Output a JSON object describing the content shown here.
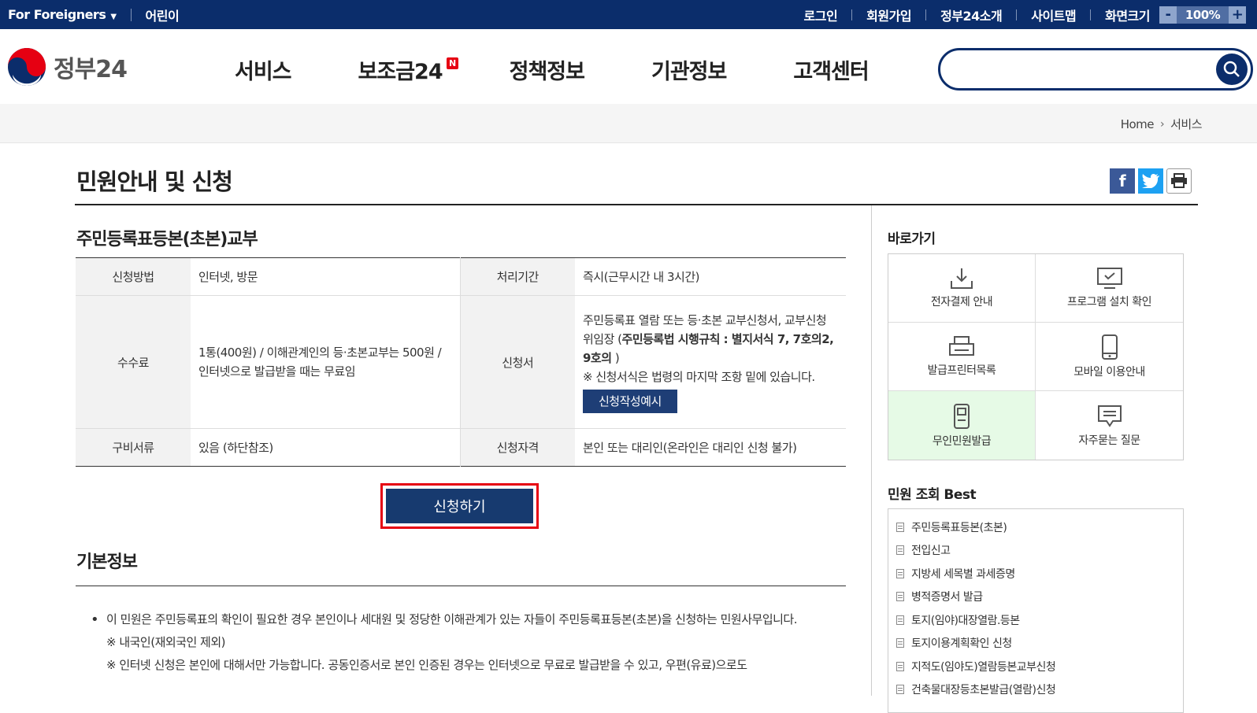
{
  "topbar": {
    "foreigners": "For Foreigners",
    "kids": "어린이",
    "links": [
      "로그인",
      "회원가입",
      "정부24소개",
      "사이트맵"
    ],
    "zoom_label": "화면크기",
    "zoom_minus": "-",
    "zoom_value": "100%",
    "zoom_plus": "+"
  },
  "header": {
    "logo_text": "정부24",
    "nav": [
      "서비스",
      "보조금24",
      "정책정보",
      "기관정보",
      "고객센터"
    ],
    "new_badge": "N",
    "search_placeholder": ""
  },
  "breadcrumb": [
    "Home",
    "서비스"
  ],
  "page_title": "민원안내 및 신청",
  "service": {
    "title": "주민등록표등본(초본)교부",
    "method_label": "신청방법",
    "method_value": "인터넷, 방문",
    "period_label": "처리기간",
    "period_value": "즉시(근무시간 내 3시간)",
    "fee_label": "수수료",
    "fee_value": "1통(400원) / 이해관계인의 등·초본교부는 500원 / 인터넷으로 발급받을 때는 무료임",
    "form_label": "신청서",
    "form_value_plain": "주민등록표 열람 또는 등·초본 교부신청서, 교부신청 위임장 (",
    "form_value_bold": "주민등록법 시행규칙 : 별지서식 7, 7호의2, 9호의",
    "form_value_end": " )",
    "form_note": "※ 신청서식은 법령의 마지막 조항 밑에 있습니다.",
    "sample_button": "신청작성예시",
    "docs_label": "구비서류",
    "docs_value": "있음 (하단참조)",
    "qual_label": "신청자격",
    "qual_value": "본인 또는 대리인(온라인은 대리인 신청 불가)",
    "apply_button": "신청하기"
  },
  "basic": {
    "title": "기본정보",
    "bullet": "•",
    "lines": [
      "이 민원은 주민등록표의 확인이 필요한 경우 본인이나 세대원 및 정당한 이해관계가 있는 자들이 주민등록표등본(초본)을 신청하는 민원사무입니다.",
      "※ 내국인(재외국인 제외)",
      "※ 인터넷 신청은 본인에 대해서만 가능합니다. 공동인증서로 본인 인증된 경우는 인터넷으로 무료로 발급받을 수 있고, 우편(유료)으로도"
    ]
  },
  "quick": {
    "title": "바로가기",
    "items": [
      {
        "label": "전자결제 안내",
        "icon": "download-icon"
      },
      {
        "label": "프로그램 설치 확인",
        "icon": "monitor-icon"
      },
      {
        "label": "발급프린터목록",
        "icon": "printer-icon"
      },
      {
        "label": "모바일 이용안내",
        "icon": "mobile-icon"
      },
      {
        "label": "무인민원발급",
        "icon": "kiosk-icon"
      },
      {
        "label": "자주묻는 질문",
        "icon": "chat-icon"
      }
    ]
  },
  "best": {
    "title": "민원 조회 Best",
    "items": [
      "주민등록표등본(초본)",
      "전입신고",
      "지방세 세목별 과세증명",
      "병적증명서 발급",
      "토지(임야)대장열람.등본",
      "토지이용계획확인 신청",
      "지적도(임야도)열람등본교부신청",
      "건축물대장등초본발급(열람)신청"
    ]
  },
  "colors": {
    "navy": "#0b2d6b",
    "apply_button": "#173a6f",
    "highlight_border": "#e60012",
    "kiosk_highlight": "#e6fae6"
  }
}
